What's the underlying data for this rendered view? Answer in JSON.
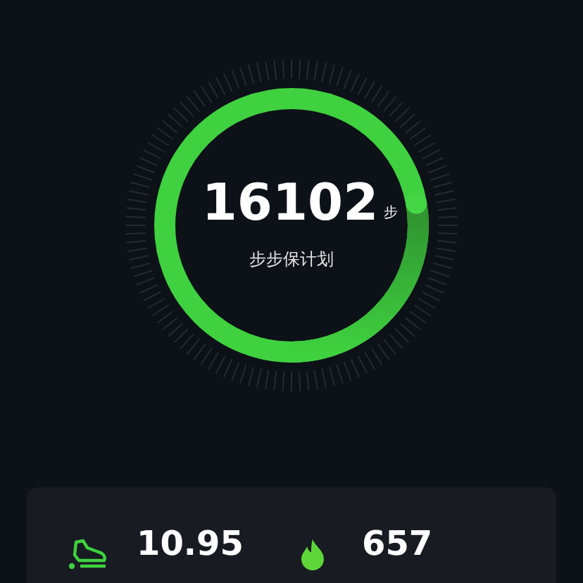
{
  "steps": {
    "value": "16102",
    "unit": "步",
    "plan": "步步保计划"
  },
  "stats": [
    {
      "kind": "distance",
      "value": "10.95"
    },
    {
      "kind": "calories",
      "value": "657"
    }
  ]
}
